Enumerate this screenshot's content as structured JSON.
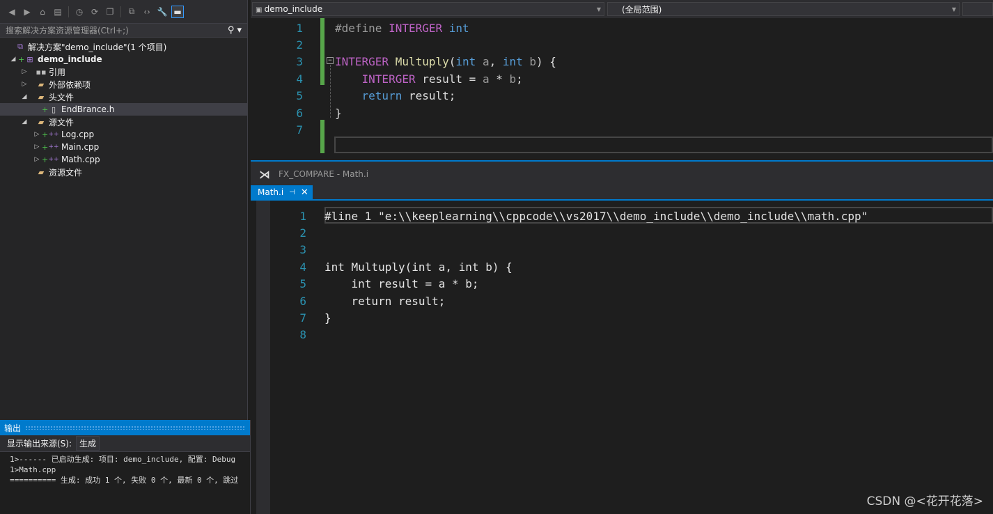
{
  "solution_explorer": {
    "search_placeholder": "搜索解决方案资源管理器(Ctrl+;)",
    "tree": [
      {
        "label": "解决方案\"demo_include\"(1 个项目)",
        "icon": "solution-icon",
        "depth": 0
      },
      {
        "label": "demo_include",
        "icon": "project-icon",
        "depth": 0,
        "bold": true
      },
      {
        "label": "引用",
        "icon": "references-icon",
        "depth": 1
      },
      {
        "label": "外部依赖项",
        "icon": "folder-icon",
        "depth": 1
      },
      {
        "label": "头文件",
        "icon": "filter-folder-icon",
        "depth": 1
      },
      {
        "label": "EndBrance.h",
        "icon": "header-file-icon",
        "depth": 2,
        "selected": true
      },
      {
        "label": "源文件",
        "icon": "filter-folder-icon",
        "depth": 1
      },
      {
        "label": "Log.cpp",
        "icon": "cpp-file-icon",
        "depth": 2
      },
      {
        "label": "Main.cpp",
        "icon": "cpp-file-icon",
        "depth": 2
      },
      {
        "label": "Math.cpp",
        "icon": "cpp-file-icon",
        "depth": 2
      },
      {
        "label": "资源文件",
        "icon": "filter-folder-icon",
        "depth": 1
      }
    ]
  },
  "output": {
    "title": "输出",
    "source_label": "显示输出来源(S):",
    "source_value": "生成",
    "lines": [
      "1>------ 已启动生成: 项目: demo_include, 配置: Debug",
      "1>Math.cpp",
      "========== 生成: 成功 1 个, 失败 0 个, 最新 0 个, 跳过"
    ]
  },
  "top_editor": {
    "project_combo": "demo_include",
    "scope_combo": "(全局范围)",
    "line_numbers": [
      "1",
      "2",
      "3",
      "4",
      "5",
      "6",
      "7"
    ],
    "lines": [
      [
        [
          "pp",
          "#define "
        ],
        [
          "macro",
          "INTERGER "
        ],
        [
          "kw",
          "int"
        ]
      ],
      [],
      [
        [
          "macro",
          "INTERGER "
        ],
        [
          "fn",
          "Multuply"
        ],
        [
          "plain",
          "("
        ],
        [
          "kw",
          "int "
        ],
        [
          "param",
          "a"
        ],
        [
          "plain",
          ", "
        ],
        [
          "kw",
          "int "
        ],
        [
          "param",
          "b"
        ],
        [
          "plain",
          ") {"
        ]
      ],
      [
        [
          "plain",
          "    "
        ],
        [
          "macro",
          "INTERGER "
        ],
        [
          "plain",
          "result = "
        ],
        [
          "param",
          "a"
        ],
        [
          "plain",
          " * "
        ],
        [
          "param",
          "b"
        ],
        [
          "plain",
          ";"
        ]
      ],
      [
        [
          "plain",
          "    "
        ],
        [
          "kw",
          "return "
        ],
        [
          "plain",
          "result;"
        ]
      ],
      [
        [
          "plain",
          "}"
        ]
      ],
      []
    ]
  },
  "compare_window": {
    "title": "FX_COMPARE - Math.i",
    "tab_label": "Math.i",
    "line_numbers": [
      "1",
      "2",
      "3",
      "4",
      "5",
      "6",
      "7",
      "8"
    ],
    "lines": [
      "#line 1 \"e:\\\\keeplearning\\\\cppcode\\\\vs2017\\\\demo_include\\\\demo_include\\\\math.cpp\"",
      "",
      "",
      "int Multuply(int a, int b) {",
      "    int result = a * b;",
      "    return result;",
      "}",
      ""
    ]
  },
  "watermark": "CSDN @<花开花落>",
  "colors": {
    "accent": "#007acc",
    "keyword": "#569cd6",
    "macro": "#bd63c5",
    "line_number": "#2b91af",
    "change_bar": "#57a64a"
  }
}
